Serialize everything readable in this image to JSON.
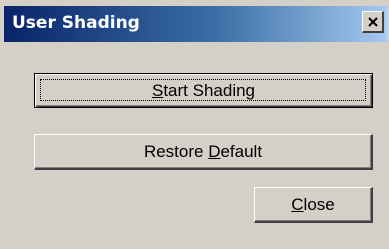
{
  "window": {
    "title": "User Shading"
  },
  "icons": {
    "close": "close-icon"
  },
  "buttons": {
    "start_shading": {
      "accel": "S",
      "rest": "tart Shading"
    },
    "restore_default": {
      "before": "Restore ",
      "accel": "D",
      "rest": "efault"
    },
    "close": {
      "accel": "C",
      "rest": "lose"
    }
  },
  "colors": {
    "dialog_face": "#d4d0c8",
    "title_start": "#0a246a",
    "title_end": "#a6caf0",
    "title_text": "#ffffff"
  }
}
